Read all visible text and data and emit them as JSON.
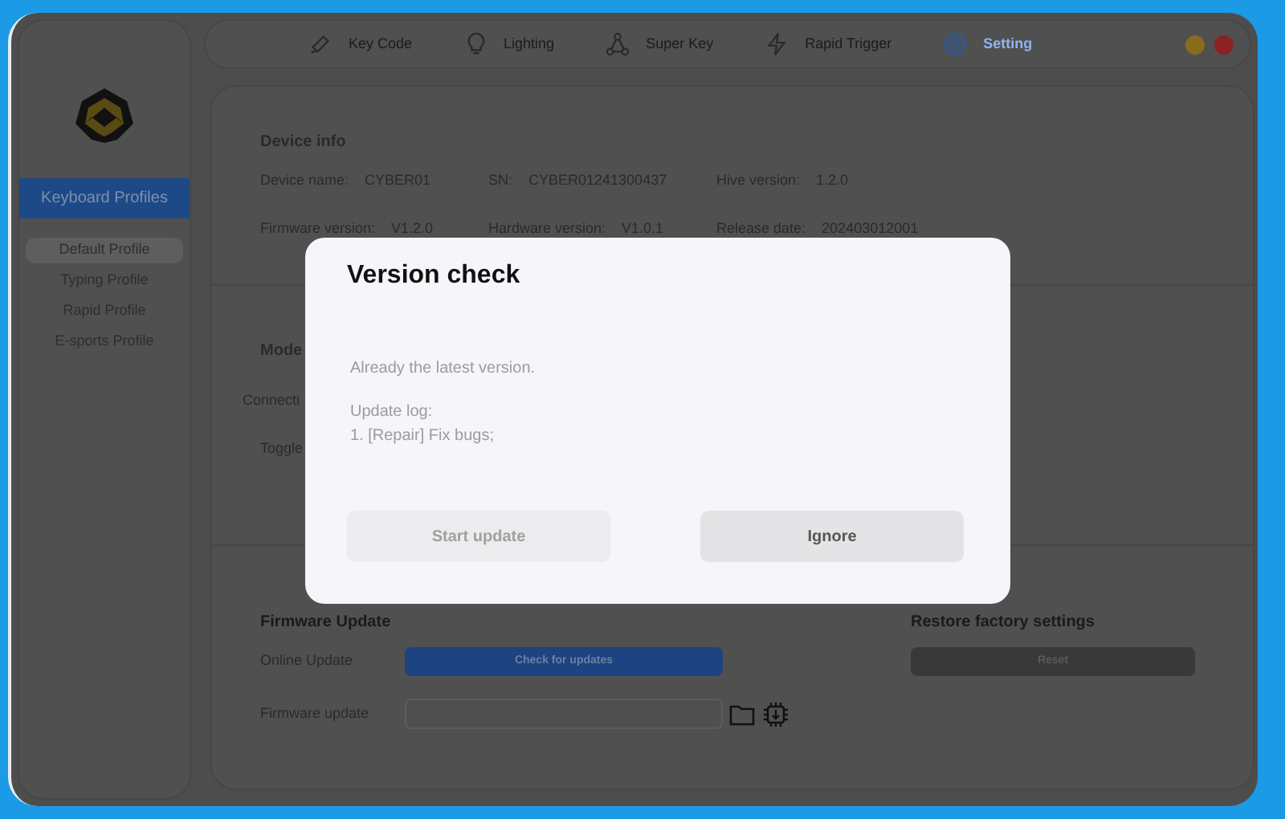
{
  "nav": {
    "tabs": [
      {
        "label": "Key Code",
        "selected": false
      },
      {
        "label": "Lighting",
        "selected": false
      },
      {
        "label": "Super Key",
        "selected": false
      },
      {
        "label": "Rapid Trigger",
        "selected": false
      },
      {
        "label": "Setting",
        "selected": true
      }
    ]
  },
  "sidebar": {
    "header": "Keyboard Profiles",
    "items": [
      {
        "label": "Default Profile",
        "selected": true
      },
      {
        "label": "Typing Profile",
        "selected": false
      },
      {
        "label": "Rapid Profile",
        "selected": false
      },
      {
        "label": "E-sports Profile",
        "selected": false
      }
    ]
  },
  "device_info": {
    "title": "Device info",
    "rows": [
      [
        {
          "label": "Device name:",
          "value": "CYBER01"
        },
        {
          "label": "SN:",
          "value": "CYBER01241300437"
        },
        {
          "label": "Hive version:",
          "value": "1.2.0"
        }
      ],
      [
        {
          "label": "Firmware version:",
          "value": "V1.2.0"
        },
        {
          "label": "Hardware version:",
          "value": "V1.0.1"
        },
        {
          "label": "Release date:",
          "value": "202403012001"
        }
      ]
    ]
  },
  "mode": {
    "title": "Mode",
    "labels": [
      "Connecti",
      "Toggle"
    ]
  },
  "firmware": {
    "title": "Firmware Update",
    "online_label": "Online Update",
    "check_button": "Check for updates",
    "file_label": "Firmware update"
  },
  "restore": {
    "title": "Restore factory settings",
    "button": "Reset"
  },
  "dialog": {
    "title": "Version check",
    "message": "Already the latest version.",
    "log_title": "Update log:",
    "log_lines": [
      "1. [Repair] Fix bugs;"
    ],
    "buttons": [
      {
        "label": "Start update",
        "disabled": true
      },
      {
        "label": "Ignore",
        "disabled": false
      }
    ]
  }
}
